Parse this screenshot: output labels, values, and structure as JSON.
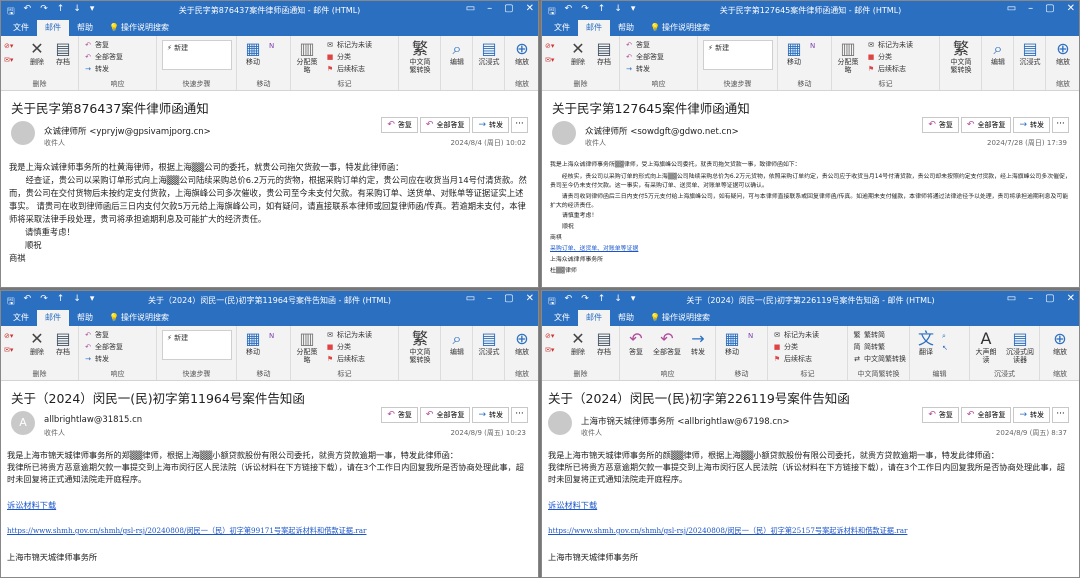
{
  "common": {
    "tabs": [
      "文件",
      "邮件",
      "帮助",
      "操作说明搜索"
    ],
    "actions": {
      "reply": "答复",
      "reply_all": "全部答复",
      "forward": "转发",
      "more": "···"
    },
    "recipient_label": "收件人",
    "ribbon": {
      "delete": "删除",
      "archive": "存档",
      "archive_group": "删除",
      "reply": "答复",
      "reply_all": "全部答复",
      "forward": "转发",
      "respond_group": "响应",
      "new_step": "新建",
      "quick_steps": "快速步骤",
      "move": "移动",
      "move_group": "移动",
      "assign": "分配策略",
      "mark_unread": "标记为未读",
      "categorize": "分类",
      "follow_up": "后续标志",
      "tags_group": "标记",
      "chinese_conv": "中文简繁转换",
      "chinese_conv_group": "中文简繁转换",
      "editing": "编辑",
      "immersive": "沉浸式",
      "zoom": "缩放",
      "zoom_group": "缩放",
      "to_trad": "繁转简",
      "to_simp": "简转繁",
      "translate": "翻译",
      "editing_group": "编辑",
      "read_aloud": "大声朗读",
      "immersive_reader": "沉浸式阅读器",
      "immersive_group": "沉浸式"
    }
  },
  "windows": [
    {
      "title": "关于民字第876437案件律师函通知 - 邮件 (HTML)",
      "subject": "关于民字第876437案件律师函通知",
      "sender": "众诚律师所 <ypryjw@gpsivamjporg.cn>",
      "date": "2024/8/4 (周日) 10:02",
      "avatar": "",
      "body": [
        "我是上海众诚律师事务所的杜黄海律师，根据上海▒▒公司的委托，就贵公司拖欠货款一事，特发此律师函：",
        "经查证，贵公司以采购订单形式向上海▒▒公司陆续采购总价6.2万元的货物，根据采购订单约定，贵公司应在收货当月14号付清货款。然而，贵公司在交付货物后未按约定支付货款，上海旗峰公司多次催收，贵公司至今未支付欠款。有采购订单、送货单、对账单等证据证实上述事实。 请贵司在收到律师函后三日内支付欠款5万元给上海旗峰公司，如有疑问，请直接联系本律师或回复律师函/传真。若逾期未支付，本律师将采取法律手段处理，贵司将承担逾期利息及可能扩大的经济责任。",
        "请慎重考虑！",
        "顺祝",
        "商祺"
      ]
    },
    {
      "title": "关于民字第127645案件律师函通知 - 邮件 (HTML)",
      "subject": "关于民字第127645案件律师函通知",
      "sender": "众诚律师所 <sowdgft@gdwo.net.cn>",
      "date": "2024/7/28 (周日) 17:39",
      "avatar": "",
      "body": [
        "我是上海众诚律师事务所▒▒律师，受上海旗峰公司委托，就贵司拖欠货款一事，致律师函如下：",
        "经核实，贵公司以采购订单的形式向上海▒▒公司陆续采购总价为6.2万元货物，依照采购订单约定，贵公司应于收货当月14号付清货款，贵公司却未按照约定支付货款，经上海旗峰公司多次催促，贵司至今仍未支付欠款。这一事实，有采购订单、送货单、对账单等证据可以确认。",
        "请贵司收到律师函后三日内支付5万元支付给上海旗峰公司，如有疑问，可与本律师直接联系或回复律师函/传真。如逾期未支付催款，本律师将通过法律途径予以处理，贵司将承担逾期利息及可能扩大的经济责任。",
        "请慎重考虑！",
        "顺祝",
        "商祺",
        "采购订单、送货单、对账单等证据",
        "上海众诚律师事务所",
        "杜▒▒律师"
      ]
    },
    {
      "title": "关于（2024）闵民一(民)初字第11964号案件告知函 - 邮件 (HTML)",
      "subject": "关于（2024）闵民一(民)初字第11964号案件告知函",
      "sender": "allbrightlaw@31815.cn",
      "date": "2024/8/9 (周五) 10:23",
      "avatar": "A",
      "body": [
        "我是上海市锦天城律师事务所的郑▒▒律师，根据上海▒▒小额贷款股份有限公司委托，就贵方贷款逾期一事，特发此律师函：",
        "我律所已将贵方恶意逾期欠款一事提交到上海市闵行区人民法院（诉讼材料在下方链接下载），请在3个工作日内回复我所是否协商处理此事，超时未回复将正式通知法院走开庭程序。",
        "诉讼材料下载",
        "https://www.shmh.gov.cn/shmh/gsl-rsj/20240808/闵民一（民）初字第99171号案起诉材料和借款证据.rar",
        "上海市锦天城律师事务所"
      ]
    },
    {
      "title": "关于（2024）闵民一(民)初字第226119号案件告知函 - 邮件 (HTML)",
      "subject": "关于（2024）闵民一(民)初字第226119号案件告知函",
      "sender": "上海市锦天城律师事务所 <allbrightlaw@67198.cn>",
      "date": "2024/8/9 (周五) 8:37",
      "avatar": "",
      "body": [
        "我是上海市锦天城律师事务所的颜▒▒律师，根据上海▒▒小额贷款股份有限公司委托，就贵方贷款逾期一事，特发此律师函：",
        "我律所已将贵方恶意逾期欠款一事提交到上海市闵行区人民法院（诉讼材料在下方链接下载），请在3个工作日内回复我所是否协商处理此事，超时未回复将正式通知法院走开庭程序。",
        "诉讼材料下载",
        "https://www.shmh.gov.cn/shmh/gsl-rsj/20240808/闵民一（民）初字第25157号案起诉材料和借款证据.rar",
        "上海市锦天城律师事务所"
      ]
    }
  ]
}
